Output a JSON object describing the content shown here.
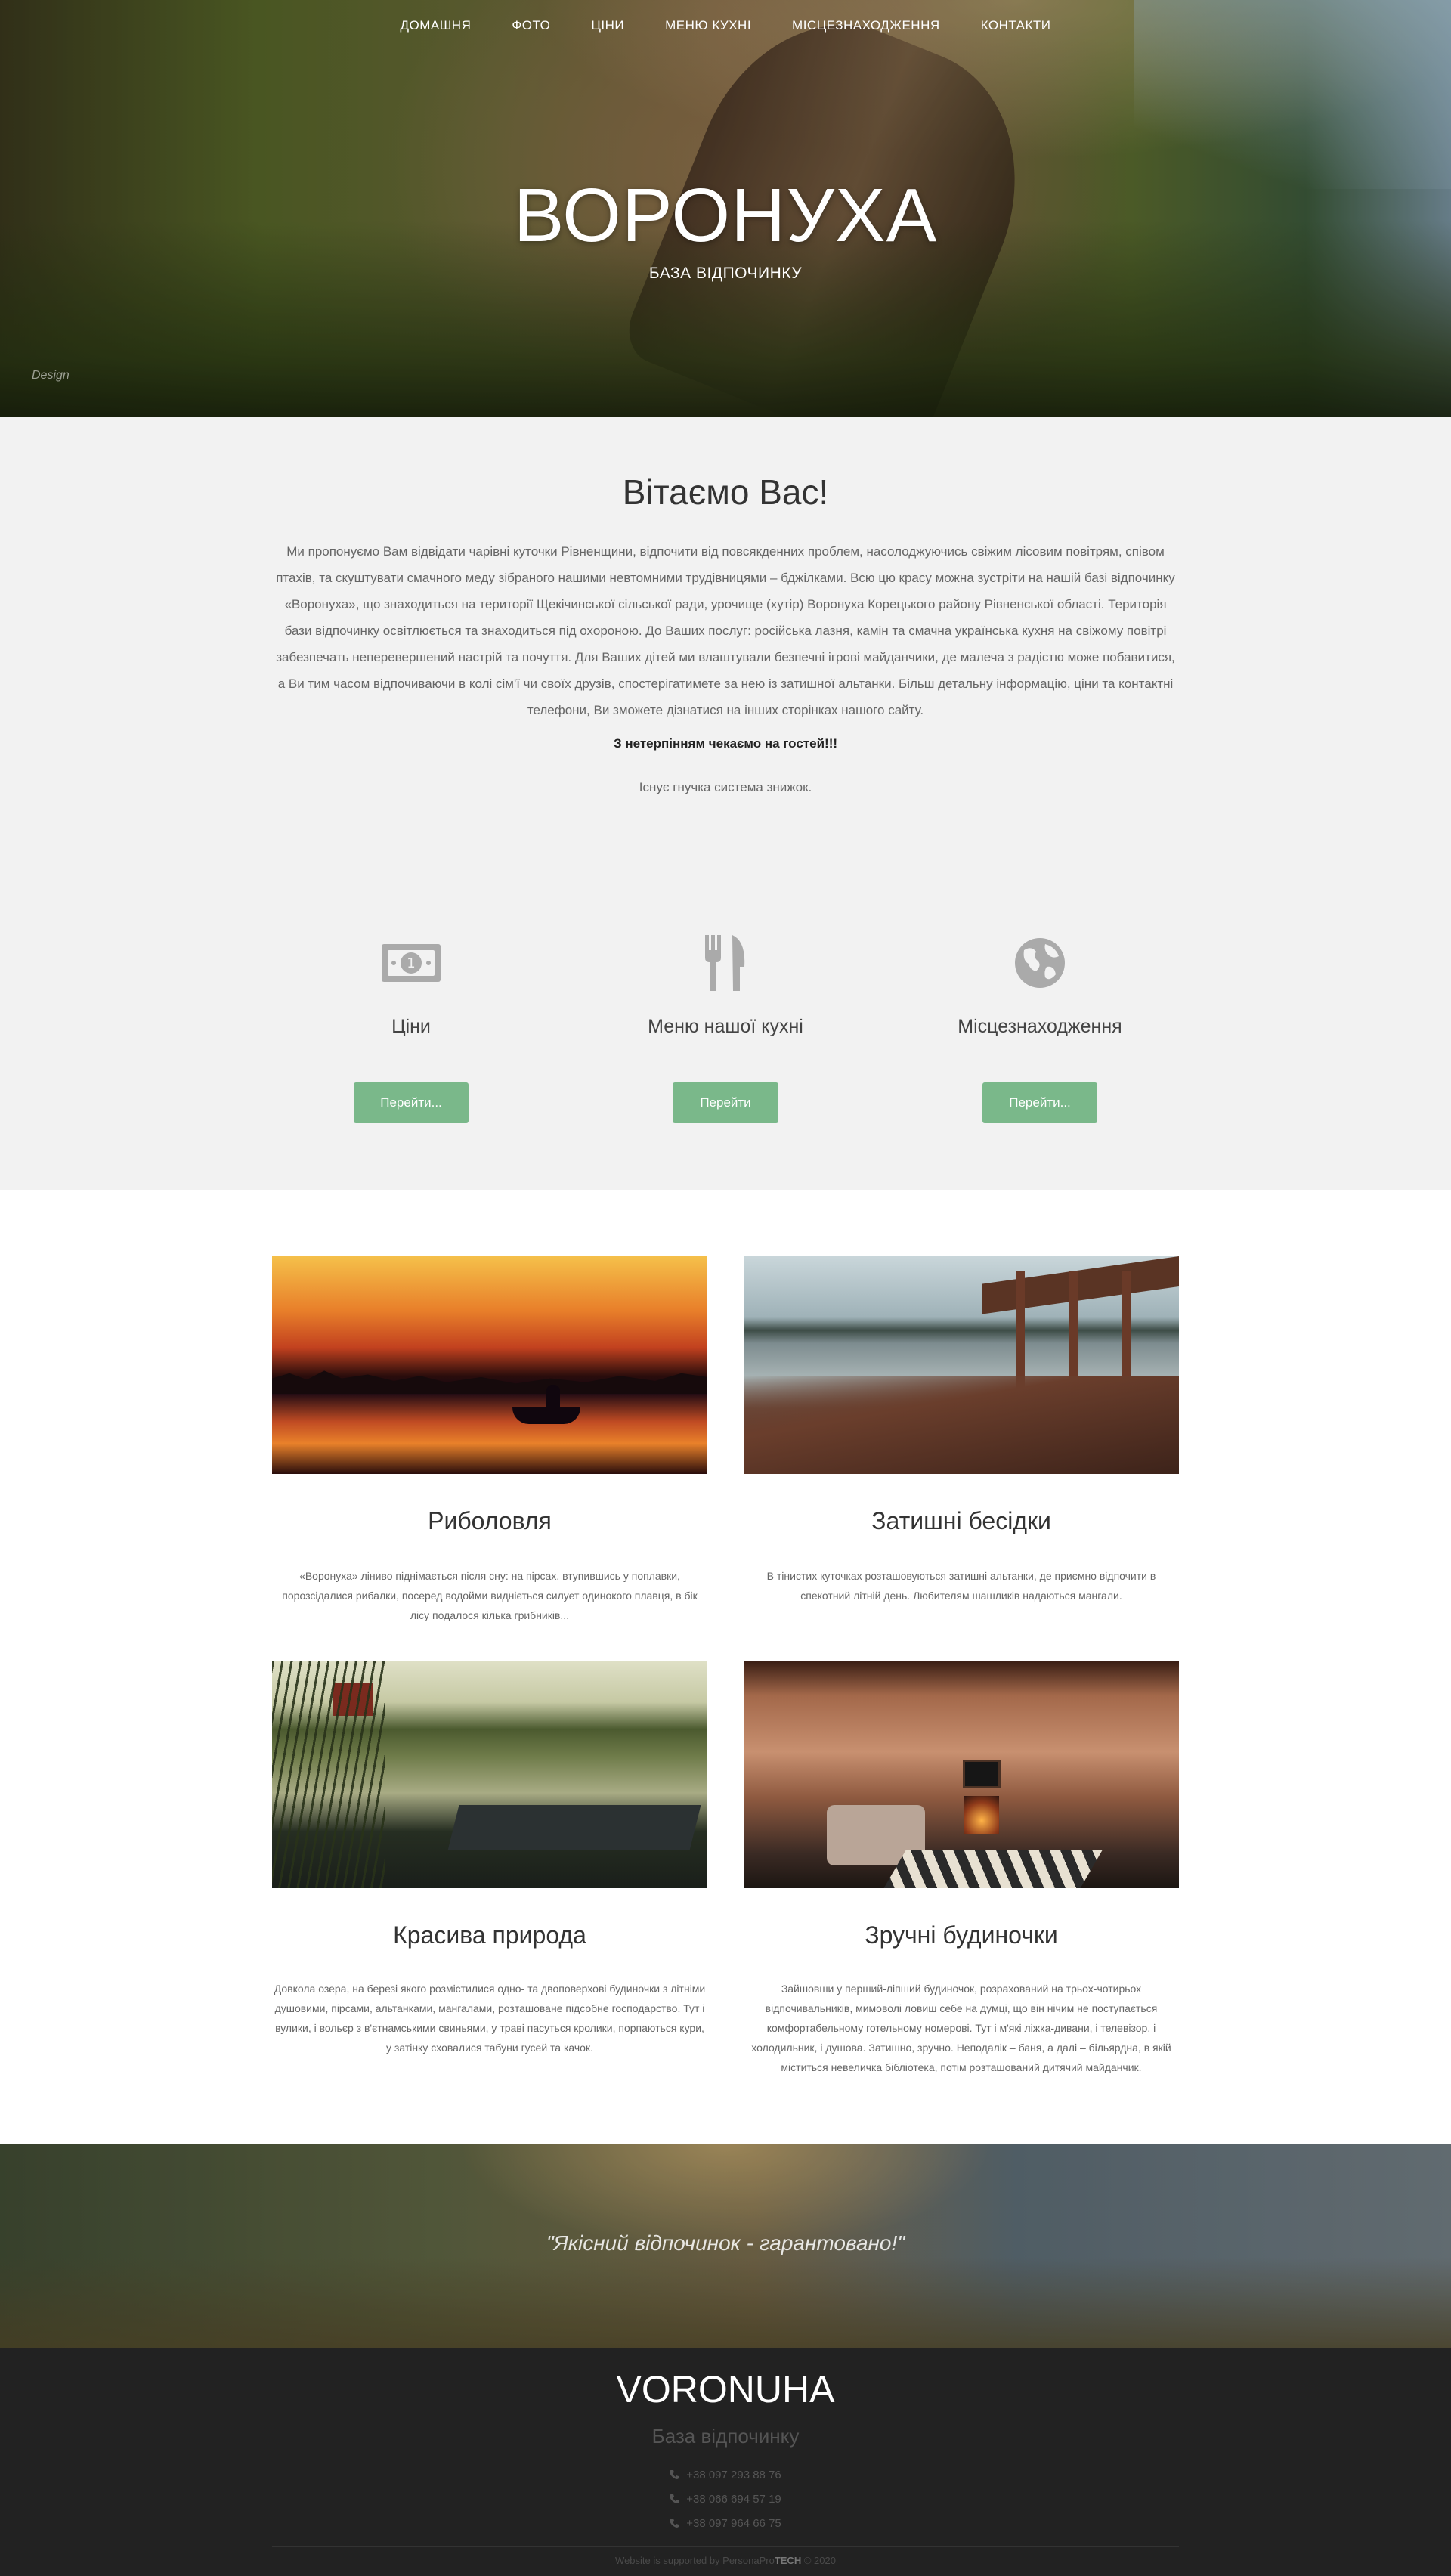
{
  "nav": {
    "items": [
      "ДОМАШНЯ",
      "ФОТО",
      "ЦІНИ",
      "МЕНЮ КУХНІ",
      "МІСЦЕЗНАХОДЖЕННЯ",
      "КОНТАКТИ"
    ]
  },
  "hero": {
    "title": "ВОРОНУХА",
    "subtitle": "БАЗА ВІДПОЧИНКУ",
    "watermark": "Design"
  },
  "welcome": {
    "title": "Вітаємо Вас!",
    "paragraph": "Ми пропонуємо Вам відвідати чарівні куточки Рівненщини, відпочити від повсякденних проблем, насолоджуючись свіжим лісовим повітрям, співом птахів, та скуштувати смачного меду зібраного нашими невтомними трудівницями – бджілками. Всю цю красу можна зустріти на нашій базі відпочинку «Воронуха», що знаходиться на території Щекічинської сільської ради, урочище (хутір) Воронуха Корецького району Рівненської області. Територія бази відпочинку освітлюється та знаходиться під охороною. До Ваших послуг: російська лазня, камін та смачна українська кухня на свіжому повітрі забезпечать неперевершений настрій та почуття. Для Ваших дітей ми влаштували безпечні ігрові майданчики, де малеча з радістю може побавитися, а Ви тим часом відпочиваючи в колі сім'ї чи своїх друзів, спостерігатимете за нею із затишної альтанки. Більш детальну інформацію, ціни та контактні телефони, Ви зможете дізнатися на інших сторінках нашого сайту.",
    "strong": "З нетерпінням чекаємо на гостей!!!",
    "note": "Існує гнучка система знижок."
  },
  "features": [
    {
      "icon": "money-icon",
      "label": "Ціни",
      "button": "Перейти..."
    },
    {
      "icon": "fork-knife-icon",
      "label": "Меню нашої кухні",
      "button": "Перейти"
    },
    {
      "icon": "globe-icon",
      "label": "Місцезнаходження",
      "button": "Перейти..."
    }
  ],
  "cards": [
    {
      "title": "Риболовля",
      "text": "«Воронуха» ліниво піднімається після сну: на пірсах, втупившись у поплавки, порозсідалися рибалки, посеред водойми видніється силует одинокого плавця, в бік лісу подалося кілька грибників..."
    },
    {
      "title": "Затишні бесідки",
      "text": "В тінистих куточках розташовуються затишні альтанки, де приємно відпочити в спекотний літній день. Любителям шашликів надаються мангали."
    },
    {
      "title": "Красива природа",
      "text": "Довкола озера, на березі якого розмістилися одно- та двоповерхові будиночки з літніми душовими, пірсами, альтанками, мангалами, розташоване підсобне господарство. Тут і вулики, і вольєр з в'єтнамськими свиньями, у траві пасуться кролики, порпаються кури, у затінку сховалися табуни гусей та качок."
    },
    {
      "title": "Зручні будиночки",
      "text": "Зайшовши у перший-ліпший будиночок, розрахований на трьох-чотирьох відпочивальників, мимоволі ловиш себе на думці, що він нічим не поступається комфортабельному готельному номерові. Тут і м'які ліжка-дивани, і телевізор, і холодильник, і душова. Затишно, зручно. Неподалік – баня, а далі – більярдна, в якій міститься невеличка бібліотека, потім розташований дитячий майданчик."
    }
  ],
  "quote": {
    "text": "\"Якісний відпочинок - гарантовано!\""
  },
  "footer": {
    "title": "VORONUHA",
    "tagline": "База відпочинку",
    "phones": [
      "+38 097 293 88 76",
      "+38 066 694 57 19",
      "+38 097 964 66 75"
    ],
    "copyright_prefix": "Website is supported by PersonaPro",
    "copyright_brand": "TECH",
    "copyright_suffix": "© 2020"
  },
  "colors": {
    "accent_button": "#7ab88a",
    "welcome_bg": "#f2f2f2",
    "footer_bg": "#222222"
  }
}
